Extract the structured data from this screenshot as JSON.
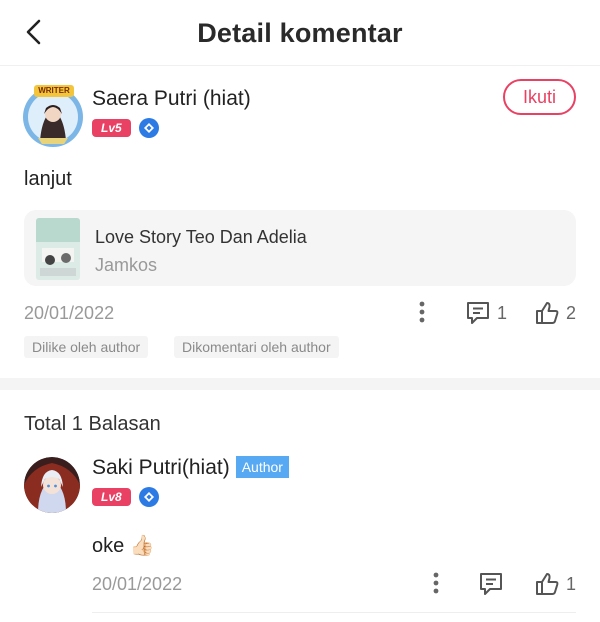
{
  "header": {
    "title": "Detail komentar"
  },
  "comment": {
    "username": "Saera Putri (hiat)",
    "level": "Lv5",
    "avatar_badge": "WRITER",
    "follow_label": "Ikuti",
    "text": "lanjut",
    "book": {
      "title": "Love Story Teo Dan Adelia",
      "author": "Jamkos"
    },
    "date": "20/01/2022",
    "comment_count": "1",
    "like_count": "2",
    "tags": [
      "Dilike oleh author",
      "Dikomentari oleh author"
    ]
  },
  "replies": {
    "total_label": "Total 1 Balasan",
    "items": [
      {
        "username": "Saki Putri(hiat)",
        "author_badge": "Author",
        "level": "Lv8",
        "text": "oke 👍🏻",
        "date": "20/01/2022",
        "like_count": "1"
      }
    ]
  },
  "colors": {
    "accent": "#e94163",
    "author_badge": "#56a9f2",
    "vip": "#2c7be5"
  },
  "icons": [
    "chevron-left-icon",
    "vip-diamond-icon",
    "more-vertical-icon",
    "comment-icon",
    "thumbs-up-icon"
  ]
}
